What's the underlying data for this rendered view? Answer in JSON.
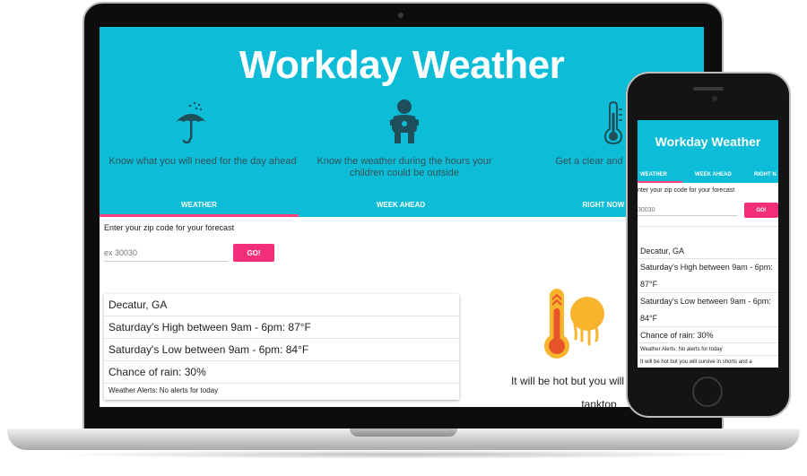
{
  "app": {
    "title": "Workday Weather"
  },
  "features": [
    {
      "icon": "umbrella-icon",
      "text": "Know what you will need for the day ahead"
    },
    {
      "icon": "baby-icon",
      "text": "Know the weather during the hours your children could be outside"
    },
    {
      "icon": "thermometer-icon",
      "text": "Get a clear and weather for"
    }
  ],
  "tabs": [
    {
      "label": "WEATHER",
      "active": true
    },
    {
      "label": "WEEK AHEAD",
      "active": false
    },
    {
      "label": "RIGHT NOW",
      "active": false
    }
  ],
  "phone_tabs": [
    {
      "label": "WEATHER"
    },
    {
      "label": "WEEK AHEAD"
    },
    {
      "label": "RIGHT N"
    }
  ],
  "zip": {
    "label": "Enter your zip code for your forecast",
    "phone_label": "nter your zip code for your forecast",
    "placeholder": "ex 30030",
    "phone_placeholder": "30030",
    "button": "GO!"
  },
  "forecast": {
    "location": "Decatur, GA",
    "high": "Saturday's High between 9am - 6pm: 87°F",
    "low": "Saturday's Low between 9am - 6pm: 84°F",
    "rain": "Chance of rain: 30%",
    "alerts": "Weather Alerts: No alerts for today",
    "phone_high_1": "Saturday's High between 9am - 6pm:",
    "phone_high_2": "87°F",
    "phone_low_1": "Saturday's Low between 9am - 6pm:",
    "phone_low_2": "84°F"
  },
  "advice": {
    "line1": "It will be hot but you will survive in sh",
    "line2": "tanktop",
    "phone": "It will be hot but you will survive in shorts and a"
  },
  "colors": {
    "accent": "#0dbcd6",
    "button": "#f42f7a",
    "indicator": "#ff4081"
  }
}
